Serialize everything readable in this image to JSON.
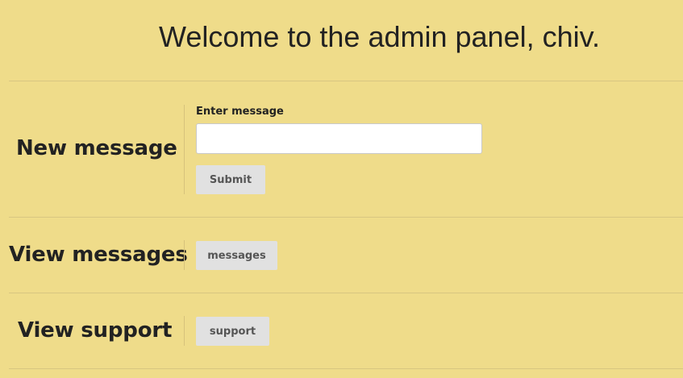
{
  "header": {
    "title": "Welcome to the admin panel, chiv."
  },
  "sections": {
    "new_message": {
      "label": "New message",
      "field_label": "Enter message",
      "input_value": "",
      "submit_label": "Submit"
    },
    "view_messages": {
      "label": "View messages",
      "button_label": "messages"
    },
    "view_support": {
      "label": "View support",
      "button_label": "support"
    }
  },
  "colors": {
    "background": "#efdc8a",
    "divider": "#d8c681",
    "button_bg": "#e1e1e1",
    "button_text": "#555555",
    "text": "#222222"
  }
}
